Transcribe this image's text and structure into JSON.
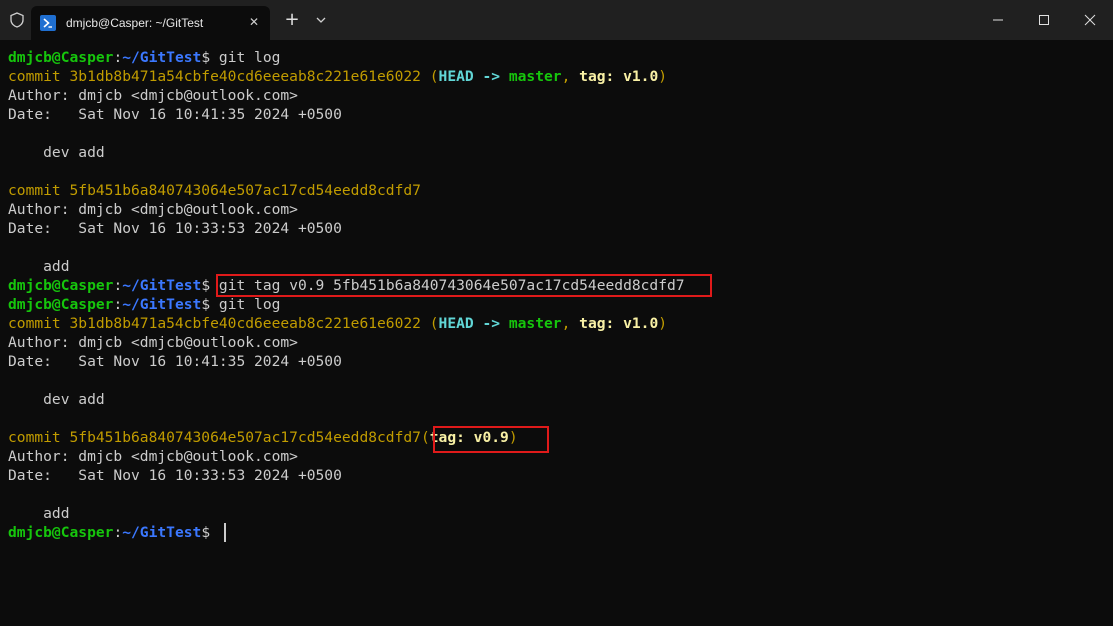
{
  "window": {
    "tab_title": "dmjcb@Casper: ~/GitTest",
    "tab_close": "✕",
    "new_tab": "+",
    "icons": {
      "shield": "shield-icon",
      "shell": "powershell-icon",
      "dropdown": "chevron-down-icon",
      "minimize": "minimize-icon",
      "maximize": "maximize-icon",
      "close": "close-icon"
    }
  },
  "prompt": {
    "user": "dmjcb@Casper",
    "sep": ":",
    "path": "~/GitTest",
    "symbol": "$"
  },
  "commands": {
    "log": "git log",
    "tag": "git tag v0.9 5fb451b6a840743064e507ac17cd54eedd8cdfd7"
  },
  "log1": {
    "c1": {
      "commit": "commit 3b1db8b471a54cbfe40cd6eeeab8c221e61e6022",
      "open": "(",
      "head": "HEAD ->",
      "branch": "master",
      "comma": ",",
      "tag": "tag: v1.0",
      "close": ")",
      "author": "Author: dmjcb <dmjcb@outlook.com>",
      "date": "Date:   Sat Nov 16 10:41:35 2024 +0500",
      "message": "    dev add"
    },
    "c2": {
      "commit": "commit 5fb451b6a840743064e507ac17cd54eedd8cdfd7",
      "author": "Author: dmjcb <dmjcb@outlook.com>",
      "date": "Date:   Sat Nov 16 10:33:53 2024 +0500",
      "message": "    add"
    }
  },
  "log2": {
    "c1": {
      "commit": "commit 3b1db8b471a54cbfe40cd6eeeab8c221e61e6022",
      "open": "(",
      "head": "HEAD ->",
      "branch": "master",
      "comma": ",",
      "tag": "tag: v1.0",
      "close": ")",
      "author": "Author: dmjcb <dmjcb@outlook.com>",
      "date": "Date:   Sat Nov 16 10:41:35 2024 +0500",
      "message": "    dev add"
    },
    "c2": {
      "commit": "commit 5fb451b6a840743064e507ac17cd54eedd8cdfd7",
      "open": "(",
      "tag": "tag: v0.9",
      "close": ")",
      "author": "Author: dmjcb <dmjcb@outlook.com>",
      "date": "Date:   Sat Nov 16 10:33:53 2024 +0500",
      "message": "    add"
    }
  },
  "colors": {
    "prompt_user": "#16c60c",
    "prompt_path": "#3b78ff",
    "commit_hash": "#c19c00",
    "head_ref": "#61d6d6",
    "branch": "#16c60c",
    "tag": "#f9f1a5",
    "highlight_box": "#e01a1a"
  }
}
